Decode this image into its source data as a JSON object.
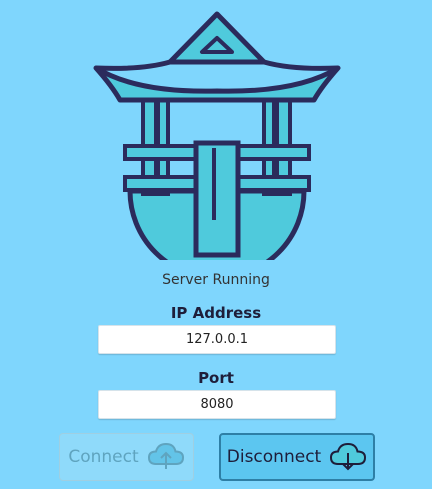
{
  "status": "Server Running",
  "ip_address": {
    "label": "IP Address",
    "value": "127.0.0.1"
  },
  "port": {
    "label": "Port",
    "value": "8080"
  },
  "buttons": {
    "connect": "Connect",
    "disconnect": "Disconnect"
  },
  "icons": {
    "logo": "pagoda-logo",
    "connect": "cloud-upload-icon",
    "disconnect": "cloud-download-icon"
  },
  "colors": {
    "background": "#7fd6fd",
    "logo_accent": "#4fcadc",
    "logo_outline": "#2b2b5c"
  }
}
